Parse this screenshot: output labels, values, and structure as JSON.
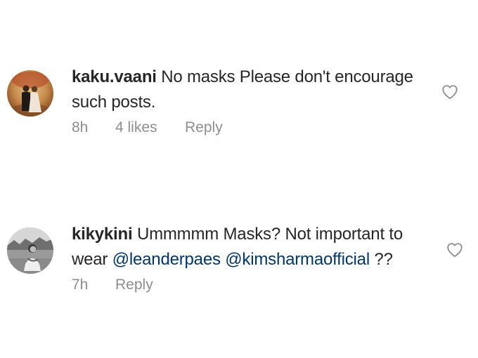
{
  "comments": [
    {
      "username": "kaku.vaani",
      "text": "No masks  Please don't encourage such posts.",
      "time": "8h",
      "likes": "4 likes",
      "reply_label": "Reply",
      "avatar_icon": "user-photo-couple",
      "like_icon": "heart-outline-icon"
    },
    {
      "username": "kikykini",
      "text_before": "Ummmmm Masks? Not important to wear ",
      "mention_1": "@leanderpaes",
      "mention_2": "@kimsharmaofficial",
      "text_after": " ??",
      "time": "7h",
      "reply_label": "Reply",
      "avatar_icon": "user-photo-outdoor-bw",
      "like_icon": "heart-outline-icon"
    }
  ],
  "colors": {
    "text": "#262626",
    "meta": "#8e8e8e",
    "mention": "#00376b"
  }
}
